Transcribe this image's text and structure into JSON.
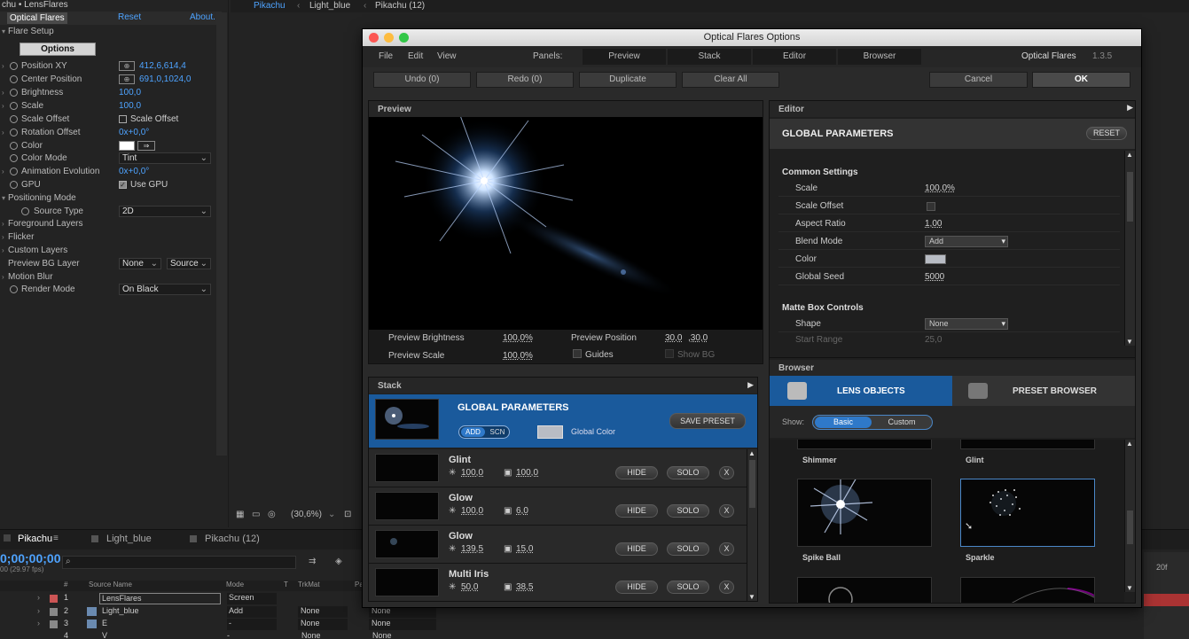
{
  "left_panel": {
    "title": "chu • LensFlares",
    "tab": "Optical Flares",
    "reset": "Reset",
    "about": "About.",
    "flare_setup": "Flare Setup",
    "options_btn": "Options",
    "rows": [
      {
        "label": "Position XY",
        "value": "412,6,614,4"
      },
      {
        "label": "Center Position",
        "value": "691,0,1024,0"
      },
      {
        "label": "Brightness",
        "value": "100,0"
      },
      {
        "label": "Scale",
        "value": "100,0"
      },
      {
        "label": "Scale Offset",
        "value": "Scale Offset"
      },
      {
        "label": "Rotation Offset",
        "value": "0x+0,0°"
      },
      {
        "label": "Color",
        "value": ""
      },
      {
        "label": "Color Mode",
        "value": "Tint"
      },
      {
        "label": "Animation Evolution",
        "value": "0x+0,0°"
      },
      {
        "label": "GPU",
        "value": "Use GPU"
      },
      {
        "label": "Positioning Mode",
        "value": ""
      },
      {
        "label": "Source Type",
        "value": "2D"
      },
      {
        "label": "Foreground Layers",
        "value": ""
      },
      {
        "label": "Flicker",
        "value": ""
      },
      {
        "label": "Custom Layers",
        "value": ""
      },
      {
        "label": "Preview BG Layer",
        "value": "None",
        "value2": "Source"
      },
      {
        "label": "Motion Blur",
        "value": ""
      },
      {
        "label": "Render Mode",
        "value": "On Black"
      }
    ]
  },
  "comp_bar": {
    "crumbs": [
      "Pikachu",
      "Light_blue",
      "Pikachu (12)"
    ]
  },
  "window": {
    "title": "Optical Flares Options",
    "menu": [
      "File",
      "Edit",
      "View"
    ],
    "panels_label": "Panels:",
    "panel_tabs": [
      "Preview",
      "Stack",
      "Editor",
      "Browser"
    ],
    "brand": "Optical Flares",
    "version": "1.3.5",
    "toolbar": {
      "undo": "Undo (0)",
      "redo": "Redo (0)",
      "duplicate": "Duplicate",
      "clear": "Clear All",
      "cancel": "Cancel",
      "ok": "OK"
    },
    "preview": {
      "title": "Preview",
      "brightness_label": "Preview Brightness",
      "brightness": "100,0%",
      "position_label": "Preview Position",
      "pos_x": "30,0",
      "pos_y": ",30,0",
      "scale_label": "Preview Scale",
      "scale": "100,0%",
      "guides": "Guides",
      "show_bg": "Show BG"
    },
    "editor": {
      "title": "Editor",
      "section": "GLOBAL PARAMETERS",
      "reset": "RESET",
      "common": "Common Settings",
      "rows": [
        {
          "label": "Scale",
          "value": "100,0%"
        },
        {
          "label": "Scale Offset",
          "value": ""
        },
        {
          "label": "Aspect Ratio",
          "value": "1,00"
        },
        {
          "label": "Blend Mode",
          "value": "Add"
        },
        {
          "label": "Color",
          "value": ""
        },
        {
          "label": "Global Seed",
          "value": "5000"
        }
      ],
      "matte": "Matte Box Controls",
      "shape_label": "Shape",
      "shape": "None",
      "start_label": "Start Range",
      "start": "25,0"
    },
    "stack": {
      "title": "Stack",
      "global": "GLOBAL PARAMETERS",
      "add": "ADD",
      "scn": "SCN",
      "global_color": "Global Color",
      "save_preset": "SAVE PRESET",
      "hide": "HIDE",
      "solo": "SOLO",
      "x": "X",
      "rows": [
        {
          "name": "Glint",
          "a": "100,0",
          "b": "100,0"
        },
        {
          "name": "Glow",
          "a": "100,0",
          "b": "6,0"
        },
        {
          "name": "Glow",
          "a": "139,5",
          "b": "15,0"
        },
        {
          "name": "Multi Iris",
          "a": "50,0",
          "b": "38,5"
        }
      ]
    },
    "browser": {
      "title": "Browser",
      "lens_objects": "LENS OBJECTS",
      "preset_browser": "PRESET BROWSER",
      "show": "Show:",
      "basic": "Basic",
      "custom": "Custom",
      "items": [
        "Shimmer",
        "Glint",
        "Spike Ball",
        "Sparkle"
      ]
    }
  },
  "timeline": {
    "tabs": [
      "Pikachu",
      "Light_blue",
      "Pikachu (12)"
    ],
    "timecode": "0;00;00;00",
    "fps": "00 (29.97 fps)",
    "zoom": "(30,6%)",
    "frame": "20f",
    "cols": [
      "#",
      "Source Name",
      "Mode",
      "T",
      "TrkMat",
      "Pa"
    ],
    "layers": [
      {
        "n": "1",
        "name": "LensFlares",
        "mode": "Screen",
        "trk": "",
        "par": ""
      },
      {
        "n": "2",
        "name": "Light_blue",
        "mode": "Add",
        "trk": "None",
        "par": "None"
      },
      {
        "n": "3",
        "name": "E",
        "mode": "-",
        "trk": "None",
        "par": "None"
      },
      {
        "n": "4",
        "name": "V",
        "mode": "-",
        "trk": "None",
        "par": "None"
      }
    ]
  }
}
